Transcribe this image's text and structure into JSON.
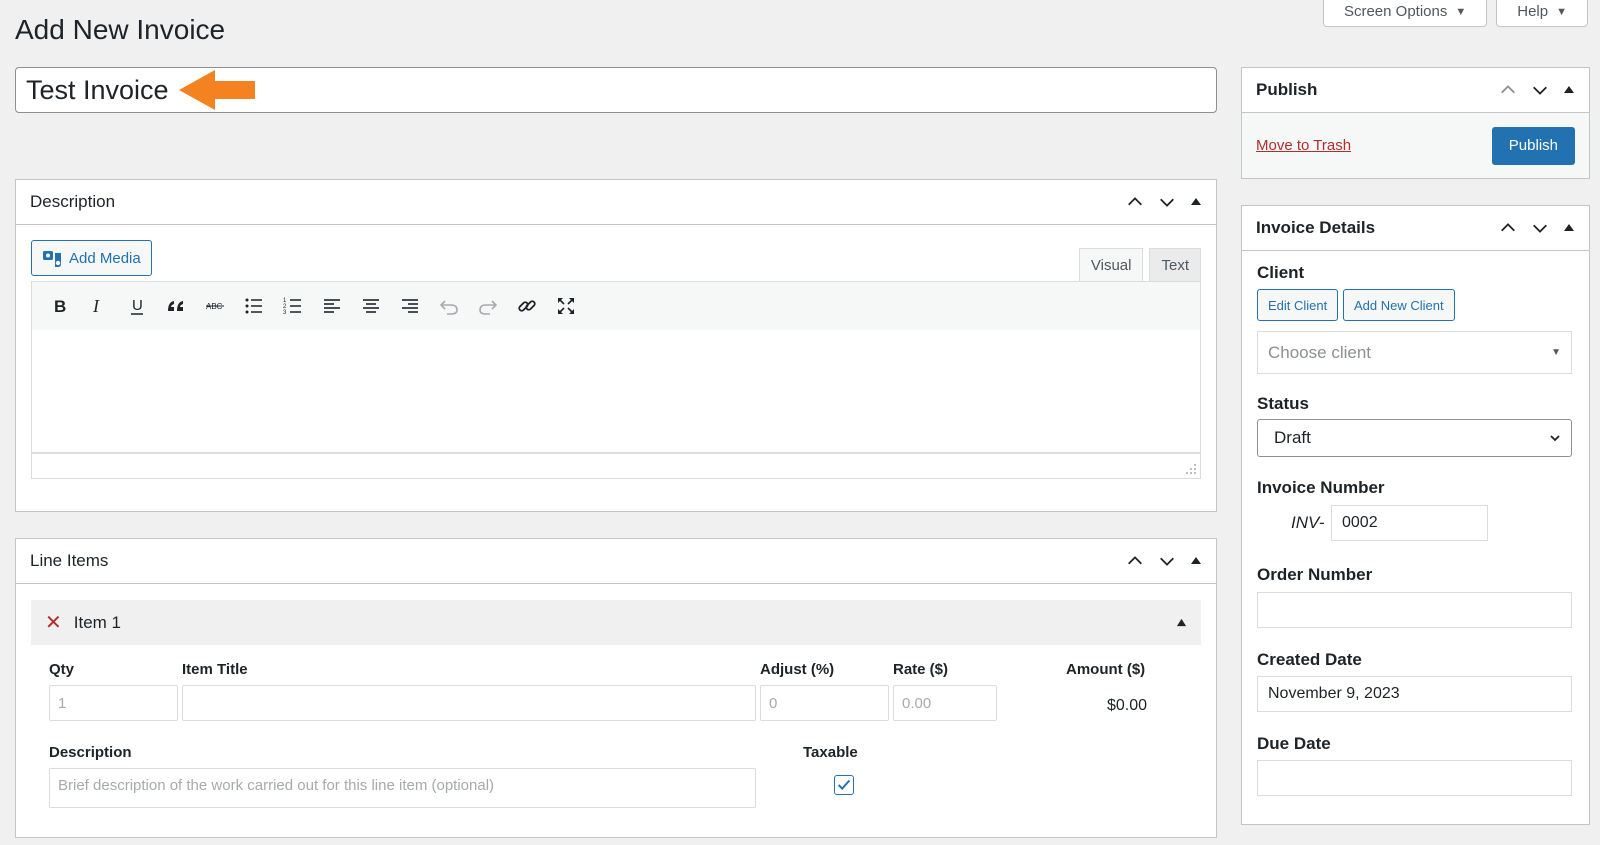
{
  "header": {
    "page_title": "Add New Invoice",
    "screen_options": "Screen Options",
    "help": "Help"
  },
  "title": {
    "value": "Test Invoice",
    "arrow_color": "#f58220"
  },
  "description_box": {
    "title": "Description",
    "add_media": "Add Media",
    "tab_visual": "Visual",
    "tab_text": "Text",
    "toolbar_icons": [
      "bold-icon",
      "italic-icon",
      "underline-icon",
      "blockquote-icon",
      "strikethrough-icon",
      "bullet-list-icon",
      "numbered-list-icon",
      "align-left-icon",
      "align-center-icon",
      "align-right-icon",
      "undo-icon",
      "redo-icon",
      "link-icon",
      "fullscreen-icon"
    ]
  },
  "line_items": {
    "title": "Line Items",
    "item": {
      "label": "Item 1",
      "qty_label": "Qty",
      "qty_placeholder": "1",
      "item_title_label": "Item Title",
      "adjust_label": "Adjust (%)",
      "adjust_placeholder": "0",
      "rate_label": "Rate ($)",
      "rate_placeholder": "0.00",
      "amount_label": "Amount ($)",
      "amount_value": "$0.00",
      "description_label": "Description",
      "description_placeholder": "Brief description of the work carried out for this line item (optional)",
      "taxable_label": "Taxable",
      "taxable_checked": true
    }
  },
  "publish_box": {
    "title": "Publish",
    "move_to_trash": "Move to Trash",
    "publish_button": "Publish"
  },
  "invoice_details": {
    "title": "Invoice Details",
    "client_label": "Client",
    "edit_client": "Edit Client",
    "add_new_client": "Add New Client",
    "client_placeholder": "Choose client",
    "status_label": "Status",
    "status_value": "Draft",
    "invoice_number_label": "Invoice Number",
    "invoice_prefix": "INV-",
    "invoice_number_value": "0002",
    "order_number_label": "Order Number",
    "order_number_value": "",
    "created_date_label": "Created Date",
    "created_date_value": "November 9, 2023",
    "due_date_label": "Due Date",
    "due_date_value": ""
  },
  "colors": {
    "accent": "#2271b1",
    "danger": "#b32d2e",
    "background": "#f0f0f1"
  }
}
